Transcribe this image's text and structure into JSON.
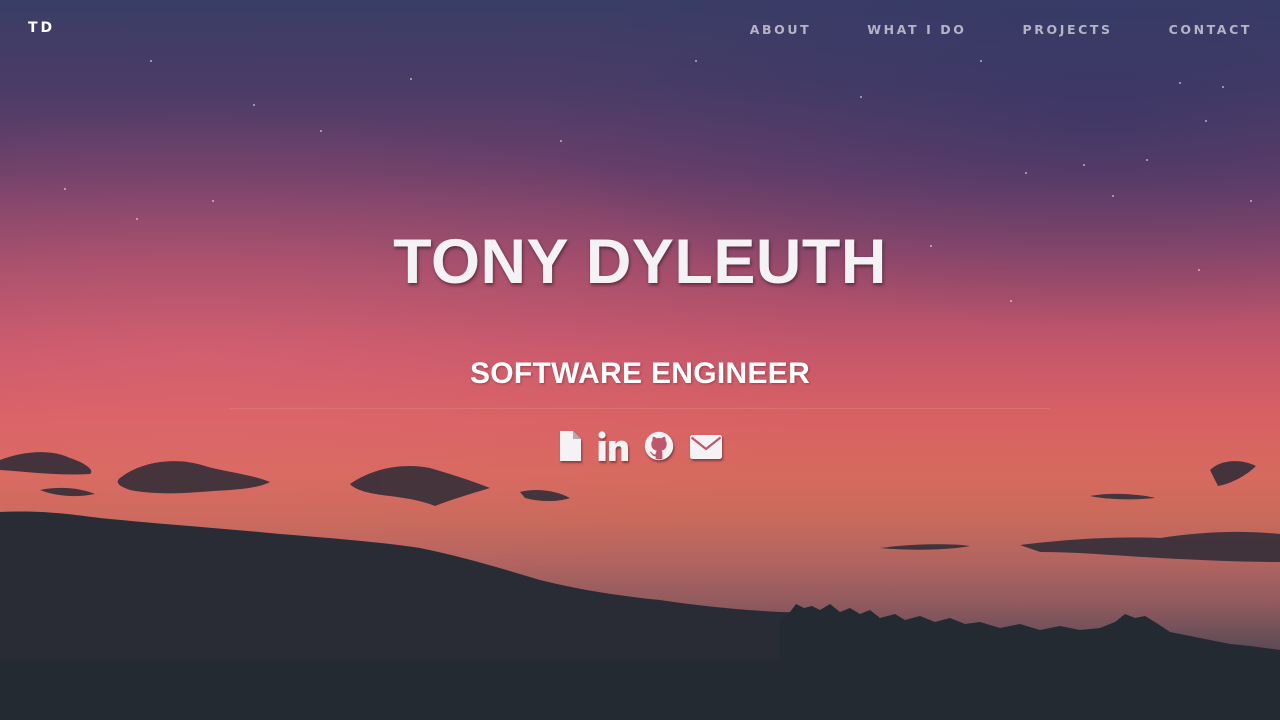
{
  "brand": "TD",
  "nav": {
    "items": [
      {
        "label": "ABOUT"
      },
      {
        "label": "WHAT I DO"
      },
      {
        "label": "PROJECTS"
      },
      {
        "label": "CONTACT"
      }
    ]
  },
  "hero": {
    "name": "TONY DYLEUTH",
    "role": "SOFTWARE ENGINEER"
  },
  "social": {
    "icons": [
      "file-icon",
      "linkedin-icon",
      "github-icon",
      "envelope-icon"
    ],
    "icon_color": "#f4f2f4"
  },
  "colors": {
    "sky_top": "#3a3d66",
    "sky_glow": "#d86163",
    "ground": "#242a32",
    "text": "#ffffff"
  }
}
